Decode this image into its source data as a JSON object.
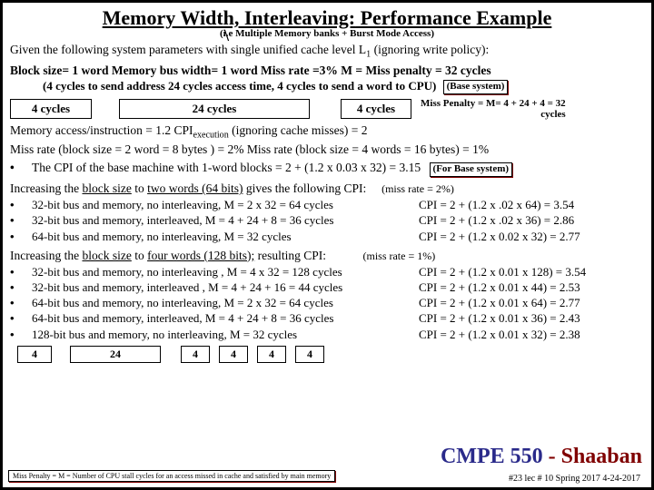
{
  "title_part1": "Memory Width, Interleaving:",
  "title_part2": " Performance Example",
  "subtitle": "(i.e Multiple Memory banks + Burst Mode Access)",
  "given": "Given the following system parameters with single unified cache level L",
  "given_sub": "1",
  "given_tail": " (ignoring write policy):",
  "params_line1": "Block size= 1 word   Memory bus width= 1  word    Miss rate =3%   M = Miss penalty = 32 cycles",
  "params_line2": "(4 cycles to send address       24 cycles  access time,    4 cycles to send a word to CPU)",
  "base_system": "(Base system)",
  "timing": {
    "c1": "4 cycles",
    "c2": "24 cycles",
    "c3": "4 cycles"
  },
  "miss_penalty_note_l1": "Miss Penalty = M= 4 + 24 + 4 = 32",
  "miss_penalty_note_l2": "cycles",
  "mem_acc": "Memory access/instruction = 1.2        CPI",
  "cpi_exec_sub": "execution",
  "mem_acc_tail": " (ignoring cache misses) = 2",
  "miss_rates": "Miss rate  (block size = 2 word = 8 bytes ) =  2%     Miss rate  (block size = 4 words = 16 bytes) = 1%",
  "base_cpi": "The CPI of the base machine with 1-word blocks  =  2 + (1.2 x 0.03 x 32) = 3.15",
  "for_base": "(For Base system)",
  "inc2_a": "Increasing the ",
  "inc2_b": "block size",
  "inc2_c": " to ",
  "inc2_d": "two words (64 bits)",
  "inc2_e": " gives the following CPI:",
  "miss2": "(miss rate = 2%)",
  "cfg2": [
    {
      "l": "32-bit bus and memory, no interleaving,    M = 2 x 32 = 64 cycles",
      "r": "CPI = 2 + (1.2 x  .02 x 64) = 3.54"
    },
    {
      "l": "32-bit bus and memory, interleaved,    M = 4 + 24 + 8  = 36 cycles",
      "r": "CPI = 2 + (1.2 x .02 x 36)  = 2.86"
    },
    {
      "l": "64-bit bus and memory, no interleaving,       M = 32 cycles",
      "r": "CPI = 2 + (1.2 x 0.02 x 32) = 2.77"
    }
  ],
  "inc4_a": "Increasing the ",
  "inc4_b": "block size",
  "inc4_c": " to ",
  "inc4_d": "four words (128 bits);",
  "inc4_e": " resulting CPI:",
  "miss1": "(miss rate = 1%)",
  "cfg4": [
    {
      "l": "32-bit bus and memory, no interleaving ,   M = 4 x 32 = 128 cycles",
      "r": "CPI = 2 + (1.2 x 0.01 x 128) = 3.54"
    },
    {
      "l": "32-bit bus and memory, interleaved ,   M = 4 + 24 + 16 = 44 cycles",
      "r": "CPI = 2 + (1.2 x 0.01 x 44) =  2.53"
    },
    {
      "l": "64-bit bus and memory, no interleaving,    M = 2 x 32 =  64 cycles",
      "r": "CPI = 2 + (1.2 x 0.01 x 64) = 2.77"
    },
    {
      "l": "64-bit bus and memory, interleaved,    M = 4 + 24 + 8 =  36 cycles",
      "r": "CPI = 2 + (1.2 x 0.01 x 36) =  2.43"
    },
    {
      "l": "128-bit bus and memory, no interleaving,    M =  32 cycles",
      "r": "CPI = 2 + (1.2 x 0.01 x 32) = 2.38"
    }
  ],
  "boxes2": {
    "a": "4",
    "b": "24",
    "c": "4",
    "d": "4",
    "e": "4",
    "f": "4"
  },
  "footer_left": "Miss Penalty = M = Number of CPU stall cycles for an access missed in cache and satisfied by main memory",
  "footer_course_a": "CMPE 550",
  "footer_course_b": " - ",
  "footer_course_c": "Shaaban",
  "footer_meta": "#23   lec # 10    Spring 2017   4-24-2017"
}
